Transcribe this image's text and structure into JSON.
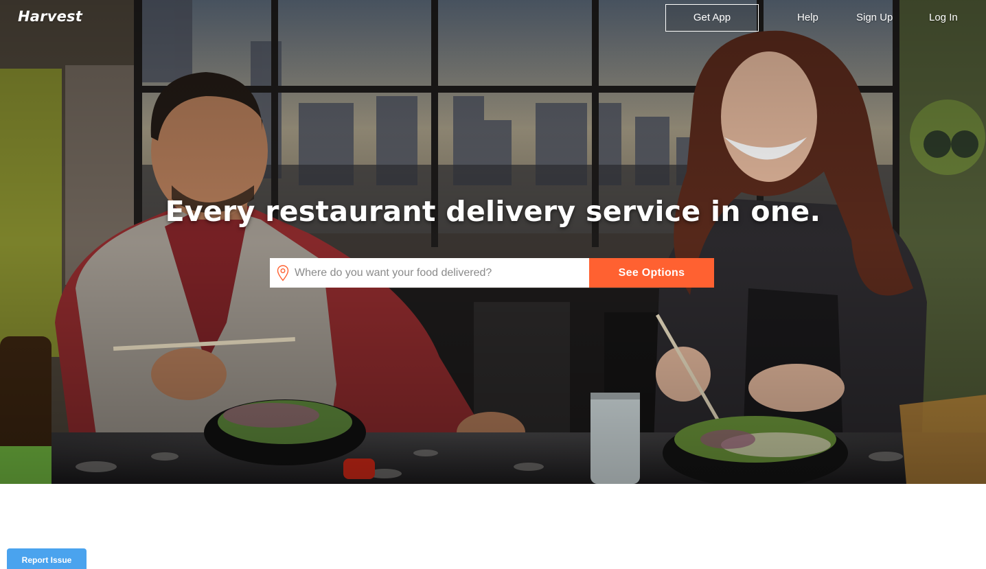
{
  "nav": {
    "logo": "Harvest",
    "get_app": "Get App",
    "help": "Help",
    "sign_up": "Sign Up",
    "log_in": "Log In"
  },
  "hero": {
    "headline": "Every restaurant delivery service in one.",
    "search_placeholder": "Where do you want your food delivered?",
    "search_value": "",
    "cta": "See Options"
  },
  "footer": {
    "report_issue": "Report Issue"
  },
  "icons": {
    "location": "map-pin-icon"
  },
  "colors": {
    "accent": "#ff6131",
    "report_button": "#4aa3ee",
    "pin": "#ff6131"
  }
}
